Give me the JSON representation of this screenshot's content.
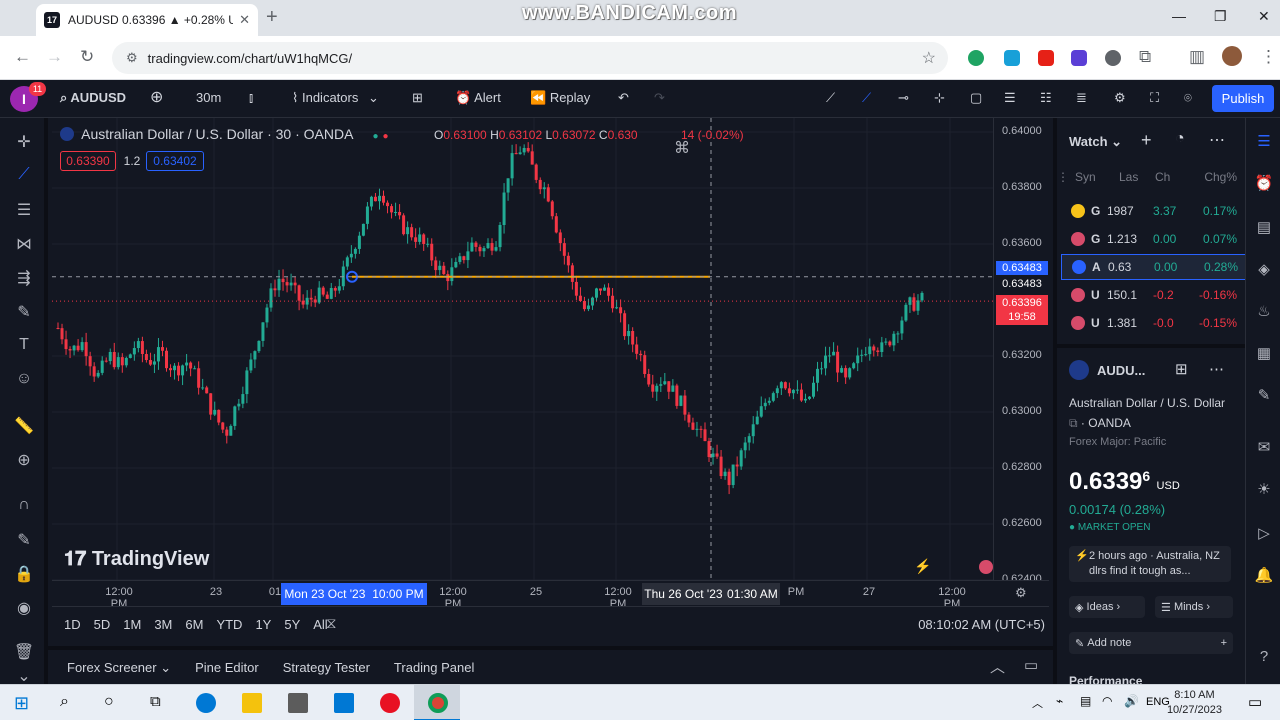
{
  "browser": {
    "tab_title": "AUDUSD 0.63396 ▲ +0.28% U",
    "url": "tradingview.com/chart/uW1hqMCG/",
    "watermark": "www.BANDICAM.com"
  },
  "toolbar": {
    "notification_count": "11",
    "avatar_letter": "I",
    "symbol": "AUDUSD",
    "interval": "30m",
    "indicators": "Indicators",
    "alert": "Alert",
    "replay": "Replay",
    "publish": "Publish"
  },
  "chart": {
    "legend_title": "Australian Dollar / U.S. Dollar · 30 · OANDA",
    "open_label": "O",
    "open": "0.63100",
    "high_label": "H",
    "high": "0.63102",
    "low_label": "L",
    "low": "0.63072",
    "close_label": "C",
    "close": "0.630",
    "change": "14 (-0.02%)",
    "sell_price": "0.63390",
    "spread": "1.2",
    "buy_price": "0.63402",
    "watermark": "TradingView",
    "colors": {
      "up": "#22ab94",
      "down": "#f23645",
      "hline": "#f7a600",
      "accent": "#2962ff"
    }
  },
  "chart_data": {
    "type": "candlestick",
    "symbol": "AUDUSD",
    "interval": "30",
    "price_ticks": [
      "0.64000",
      "0.63800",
      "0.63600",
      "0.63200",
      "0.63000",
      "0.62800",
      "0.62600",
      "0.62400"
    ],
    "time_ticks": [
      "12:00 PM",
      "23",
      "01",
      "12:00 PM",
      "25",
      "12:00 PM",
      "PM",
      "27",
      "12:00 PM"
    ],
    "ylim": [
      0.624,
      0.64
    ],
    "horizontal_line": 0.63483,
    "crosshair_price": "0.63483",
    "last_price": "0.63396",
    "countdown": "19:58",
    "crosshair_time_a": "Mon 23 Oct '23",
    "crosshair_time_a2": "10:00 PM",
    "crosshair_time_b": "Thu 26 Oct '23",
    "crosshair_time_b2": "01:30 AM",
    "path": [
      0.633,
      0.6322,
      0.6325,
      0.6312,
      0.632,
      0.6316,
      0.6324,
      0.6318,
      0.6321,
      0.6315,
      0.6318,
      0.631,
      0.63,
      0.6292,
      0.6305,
      0.6318,
      0.6335,
      0.6348,
      0.6345,
      0.6338,
      0.6342,
      0.634,
      0.6348,
      0.636,
      0.6372,
      0.638,
      0.637,
      0.6365,
      0.6362,
      0.6355,
      0.6348,
      0.6352,
      0.636,
      0.6358,
      0.6362,
      0.6388,
      0.6395,
      0.6385,
      0.6378,
      0.636,
      0.6345,
      0.6335,
      0.6345,
      0.634,
      0.6328,
      0.6322,
      0.631,
      0.6312,
      0.6305,
      0.6298,
      0.629,
      0.6282,
      0.6275,
      0.6285,
      0.6295,
      0.6305,
      0.6312,
      0.6308,
      0.6302,
      0.6315,
      0.6322,
      0.631,
      0.6318,
      0.6326,
      0.6322,
      0.633,
      0.6338,
      0.634
    ]
  },
  "timerange": {
    "ranges": [
      "1D",
      "5D",
      "1M",
      "3M",
      "6M",
      "YTD",
      "1Y",
      "5Y",
      "All"
    ],
    "clock": "08:10:02 AM (UTC+5)"
  },
  "bottom_tabs": [
    "Forex Screener",
    "Pine Editor",
    "Strategy Tester",
    "Trading Panel"
  ],
  "watchlist": {
    "title": "Watch",
    "columns": [
      "Syn",
      "Las",
      "Ch",
      "Chg%"
    ],
    "rows": [
      {
        "sym": "G",
        "last": "1987",
        "ch": "3.37",
        "chp": "0.17%",
        "dir": "pos",
        "color": "#f7c31a"
      },
      {
        "sym": "G",
        "last": "1.213",
        "ch": "0.00",
        "chp": "0.07%",
        "dir": "pos",
        "color": "#d64b6a"
      },
      {
        "sym": "A",
        "last": "0.63",
        "ch": "0.00",
        "chp": "0.28%",
        "dir": "pos",
        "color": "#2962ff"
      },
      {
        "sym": "U",
        "last": "150.1",
        "ch": "-0.2",
        "chp": "-0.16%",
        "dir": "neg",
        "color": "#d64b6a"
      },
      {
        "sym": "U",
        "last": "1.381",
        "ch": "-0.0",
        "chp": "-0.15%",
        "dir": "neg",
        "color": "#d64b6a"
      }
    ]
  },
  "detail": {
    "symbol": "AUDU...",
    "name": "Australian Dollar / U.S. Dollar",
    "exchange": "OANDA",
    "category": "Forex Major: Pacific",
    "price_main": "0.6339",
    "price_small": "6",
    "currency": "USD",
    "change": "0.00174 (0.28%)",
    "status": "MARKET OPEN",
    "news": "2 hours ago · Australia, NZ dlrs find it tough as...",
    "ideas": "Ideas",
    "minds": "Minds",
    "add_note": "Add note",
    "performance": "Performance"
  },
  "taskbar": {
    "lang": "ENG",
    "time": "8:10 AM",
    "date": "10/27/2023"
  }
}
